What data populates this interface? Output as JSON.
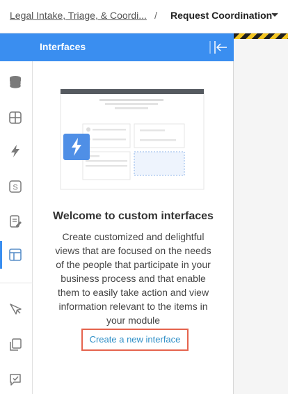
{
  "breadcrumb": {
    "parent_label": "Legal Intake, Triage, & Coordi...",
    "separator": "/",
    "current_label": "Request Coordination"
  },
  "sidebar": {
    "items": [
      {
        "icon": "database-icon"
      },
      {
        "icon": "grid-icon"
      },
      {
        "icon": "lightning-icon"
      },
      {
        "icon": "s-badge-icon",
        "text": "S"
      },
      {
        "icon": "edit-document-icon"
      },
      {
        "icon": "layout-icon",
        "active": true
      },
      {
        "icon": "pin-cursor-icon"
      },
      {
        "icon": "copy-icon"
      },
      {
        "icon": "checkbox-icon"
      }
    ]
  },
  "panel": {
    "title": "Interfaces",
    "welcome_title": "Welcome to custom interfaces",
    "welcome_body": "Create customized and delightful views that are focused on the needs of the people that participate in your business process and that enable them to easily take action and view information relevant to the items in your module",
    "create_link": "Create a new interface"
  },
  "colors": {
    "accent": "#3a8ef0",
    "link": "#2f8fc7",
    "highlight_border": "#e5634d"
  }
}
